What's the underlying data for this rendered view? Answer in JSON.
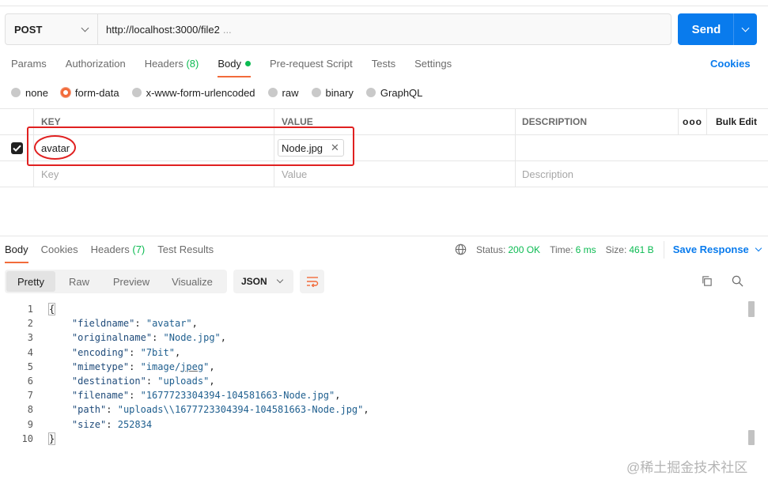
{
  "request": {
    "method": "POST",
    "url": "http://localhost:3000/file2",
    "url_overflow": "...",
    "send_label": "Send"
  },
  "request_tabs": [
    {
      "label": "Params"
    },
    {
      "label": "Authorization"
    },
    {
      "label": "Headers",
      "count": "(8)"
    },
    {
      "label": "Body"
    },
    {
      "label": "Pre-request Script"
    },
    {
      "label": "Tests"
    },
    {
      "label": "Settings"
    }
  ],
  "cookies_label": "Cookies",
  "body_types": [
    {
      "label": "none"
    },
    {
      "label": "form-data"
    },
    {
      "label": "x-www-form-urlencoded"
    },
    {
      "label": "raw"
    },
    {
      "label": "binary"
    },
    {
      "label": "GraphQL"
    }
  ],
  "params_table": {
    "headers": {
      "key": "KEY",
      "value": "VALUE",
      "description": "DESCRIPTION",
      "more": "ooo",
      "bulk_edit": "Bulk Edit"
    },
    "rows": [
      {
        "key": "avatar",
        "file": "Node.jpg",
        "remove": "✕",
        "description": ""
      }
    ],
    "placeholders": {
      "key": "Key",
      "value": "Value",
      "description": "Description"
    }
  },
  "response": {
    "tabs": [
      {
        "label": "Body"
      },
      {
        "label": "Cookies"
      },
      {
        "label": "Headers",
        "count": "(7)"
      },
      {
        "label": "Test Results"
      }
    ],
    "status_label": "Status:",
    "status": "200 OK",
    "time_label": "Time:",
    "time": "6 ms",
    "size_label": "Size:",
    "size": "461 B",
    "save_label": "Save Response",
    "views": [
      "Pretty",
      "Raw",
      "Preview",
      "Visualize"
    ],
    "format": "JSON"
  },
  "code": {
    "lines": [
      "1",
      "2",
      "3",
      "4",
      "5",
      "6",
      "7",
      "8",
      "9",
      "10"
    ],
    "open": "{",
    "close": "}",
    "fields": [
      {
        "key": "\"fieldname\"",
        "value": "\"avatar\"",
        "comma": ","
      },
      {
        "key": "\"originalname\"",
        "value": "\"Node.jpg\"",
        "comma": ","
      },
      {
        "key": "\"encoding\"",
        "value": "\"7bit\"",
        "comma": ","
      },
      {
        "key": "\"mimetype\"",
        "value_pre": "\"image/",
        "value_u": "jpeg",
        "value_post": "\"",
        "comma": ","
      },
      {
        "key": "\"destination\"",
        "value": "\"uploads\"",
        "comma": ","
      },
      {
        "key": "\"filename\"",
        "value": "\"1677723304394-104581663-Node.jpg\"",
        "comma": ","
      },
      {
        "key": "\"path\"",
        "value": "\"uploads\\\\1677723304394-104581663-Node.jpg\"",
        "comma": ","
      },
      {
        "key": "\"size\"",
        "value": "252834",
        "comma": ""
      }
    ]
  },
  "watermark": "@稀土掘金技术社区"
}
